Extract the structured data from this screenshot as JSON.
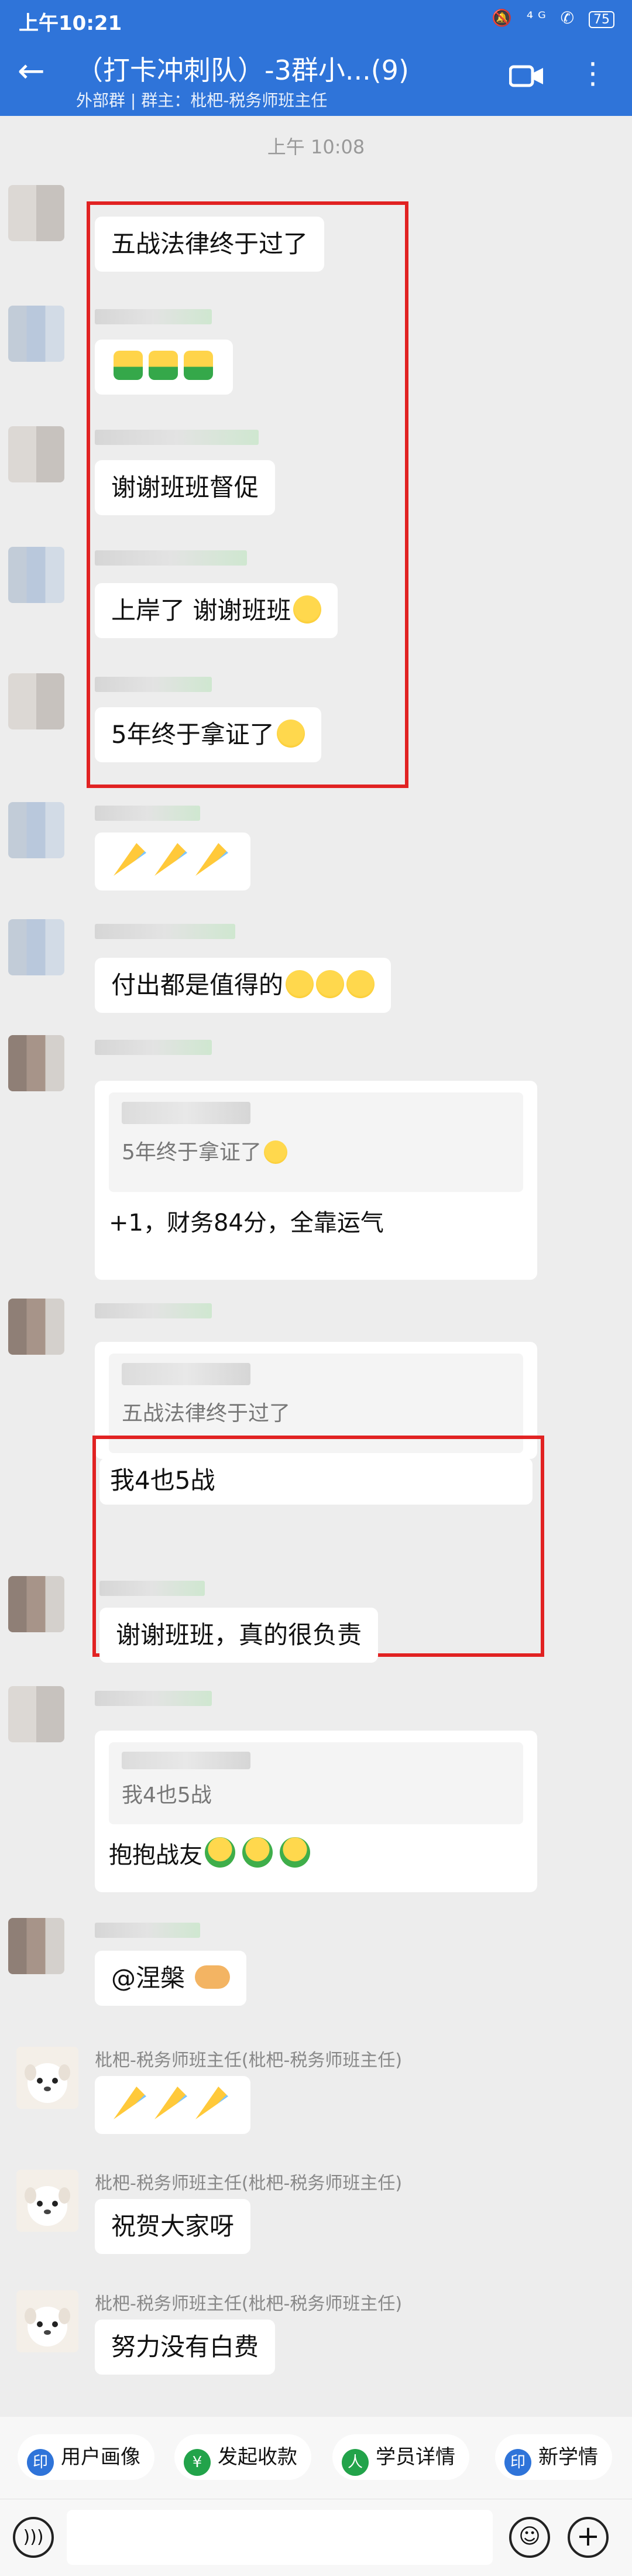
{
  "status_bar": {
    "time": "上午10:21",
    "icons": "🔕 ⁴ᴳ ✆",
    "battery": "75"
  },
  "header": {
    "title": "（打卡冲刺队）-3群小...(9)",
    "subtitle": "外部群 | 群主：枇杷-税务师班主任"
  },
  "timestamp": "上午 10:08",
  "messages": {
    "m1": "五战法律终于过了",
    "m3": "谢谢班班督促",
    "m4": "上岸了 谢谢班班",
    "m5": "5年终于拿证了",
    "m7": "付出都是值得的",
    "m8_quote": "5年终于拿证了",
    "m8": "+1，财务84分，全靠运气",
    "m9_quote": "五战法律终于过了",
    "m9a": "我4也5战",
    "m9b": "谢谢班班，真的很负责",
    "m10_quote": "我4也5战",
    "m10": "抱抱战友",
    "m11": "@涅槃",
    "m12_name": "枇杷-税务师班主任(枇杷-税务师班主任)",
    "m13_name": "枇杷-税务师班主任(枇杷-税务师班主任)",
    "m13": "祝贺大家呀",
    "m14_name": "枇杷-税务师班主任(枇杷-税务师班主任)",
    "m14": "努力没有白费"
  },
  "quick_actions": [
    {
      "label": "用户画像",
      "icon": "印",
      "color": "#2f74d9"
    },
    {
      "label": "发起收款",
      "icon": "¥",
      "color": "#22a34a"
    },
    {
      "label": "学员详情",
      "icon": "人",
      "color": "#22a34a"
    },
    {
      "label": "新学情",
      "icon": "印",
      "color": "#2f74d9"
    }
  ]
}
